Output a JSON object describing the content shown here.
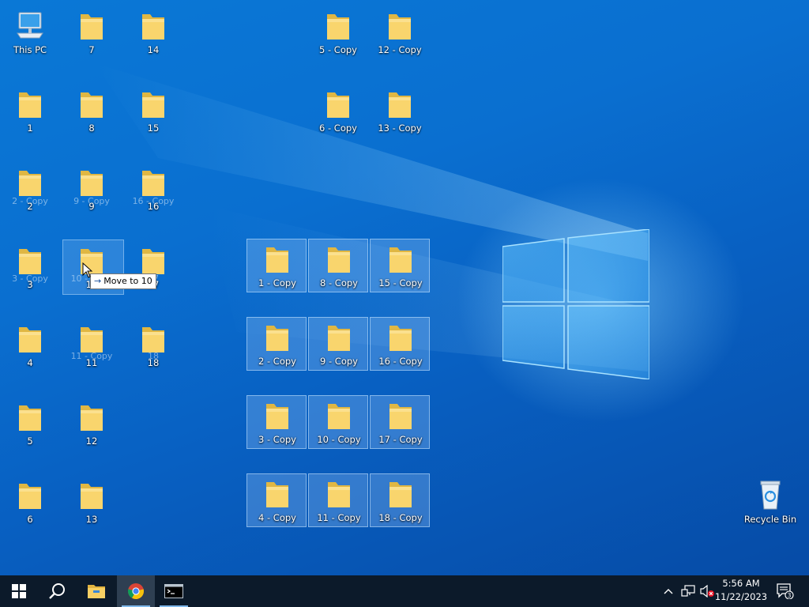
{
  "desktop": {
    "this_pc": "This PC",
    "recycle_bin": "Recycle Bin",
    "folders": {
      "f7": "7",
      "f14": "14",
      "f1": "1",
      "f8": "8",
      "f15": "15",
      "f2": "2",
      "f9": "9",
      "f16": "16",
      "f3": "3",
      "f10": "10",
      "f17": "17",
      "f4": "4",
      "f11": "11",
      "f18": "18",
      "f5": "5",
      "f12": "12",
      "f6": "6",
      "f13": "13",
      "c5": "5 - Copy",
      "c12": "12 - Copy",
      "c6": "6 - Copy",
      "c13": "13 - Copy",
      "c1": "1 - Copy",
      "c8": "8 - Copy",
      "c15": "15 - Copy",
      "c2": "2 - Copy",
      "c9": "9 - Copy",
      "c16": "16 - Copy",
      "c3": "3 - Copy",
      "c10": "10 - Copy",
      "c17": "17 - Copy",
      "c4": "4 - Copy",
      "c11": "11 - Copy",
      "c18": "18 - Copy"
    },
    "ghosts": {
      "g2": "2 - Copy",
      "g9": "9 - Copy",
      "g16": "16 - Copy",
      "g3": "3 - Copy",
      "g10": "10 - Copy",
      "g17": "17",
      "g11": "11 - Copy",
      "g18": "18"
    },
    "tooltip": "Move to 10"
  },
  "taskbar": {
    "clock_time": "5:56 AM",
    "clock_date": "11/22/2023",
    "notification_count": "3"
  },
  "icons": {
    "start": "windows-logo-icon",
    "search": "search-icon",
    "explorer": "file-explorer-icon",
    "chrome": "chrome-icon",
    "terminal": "command-prompt-icon"
  }
}
